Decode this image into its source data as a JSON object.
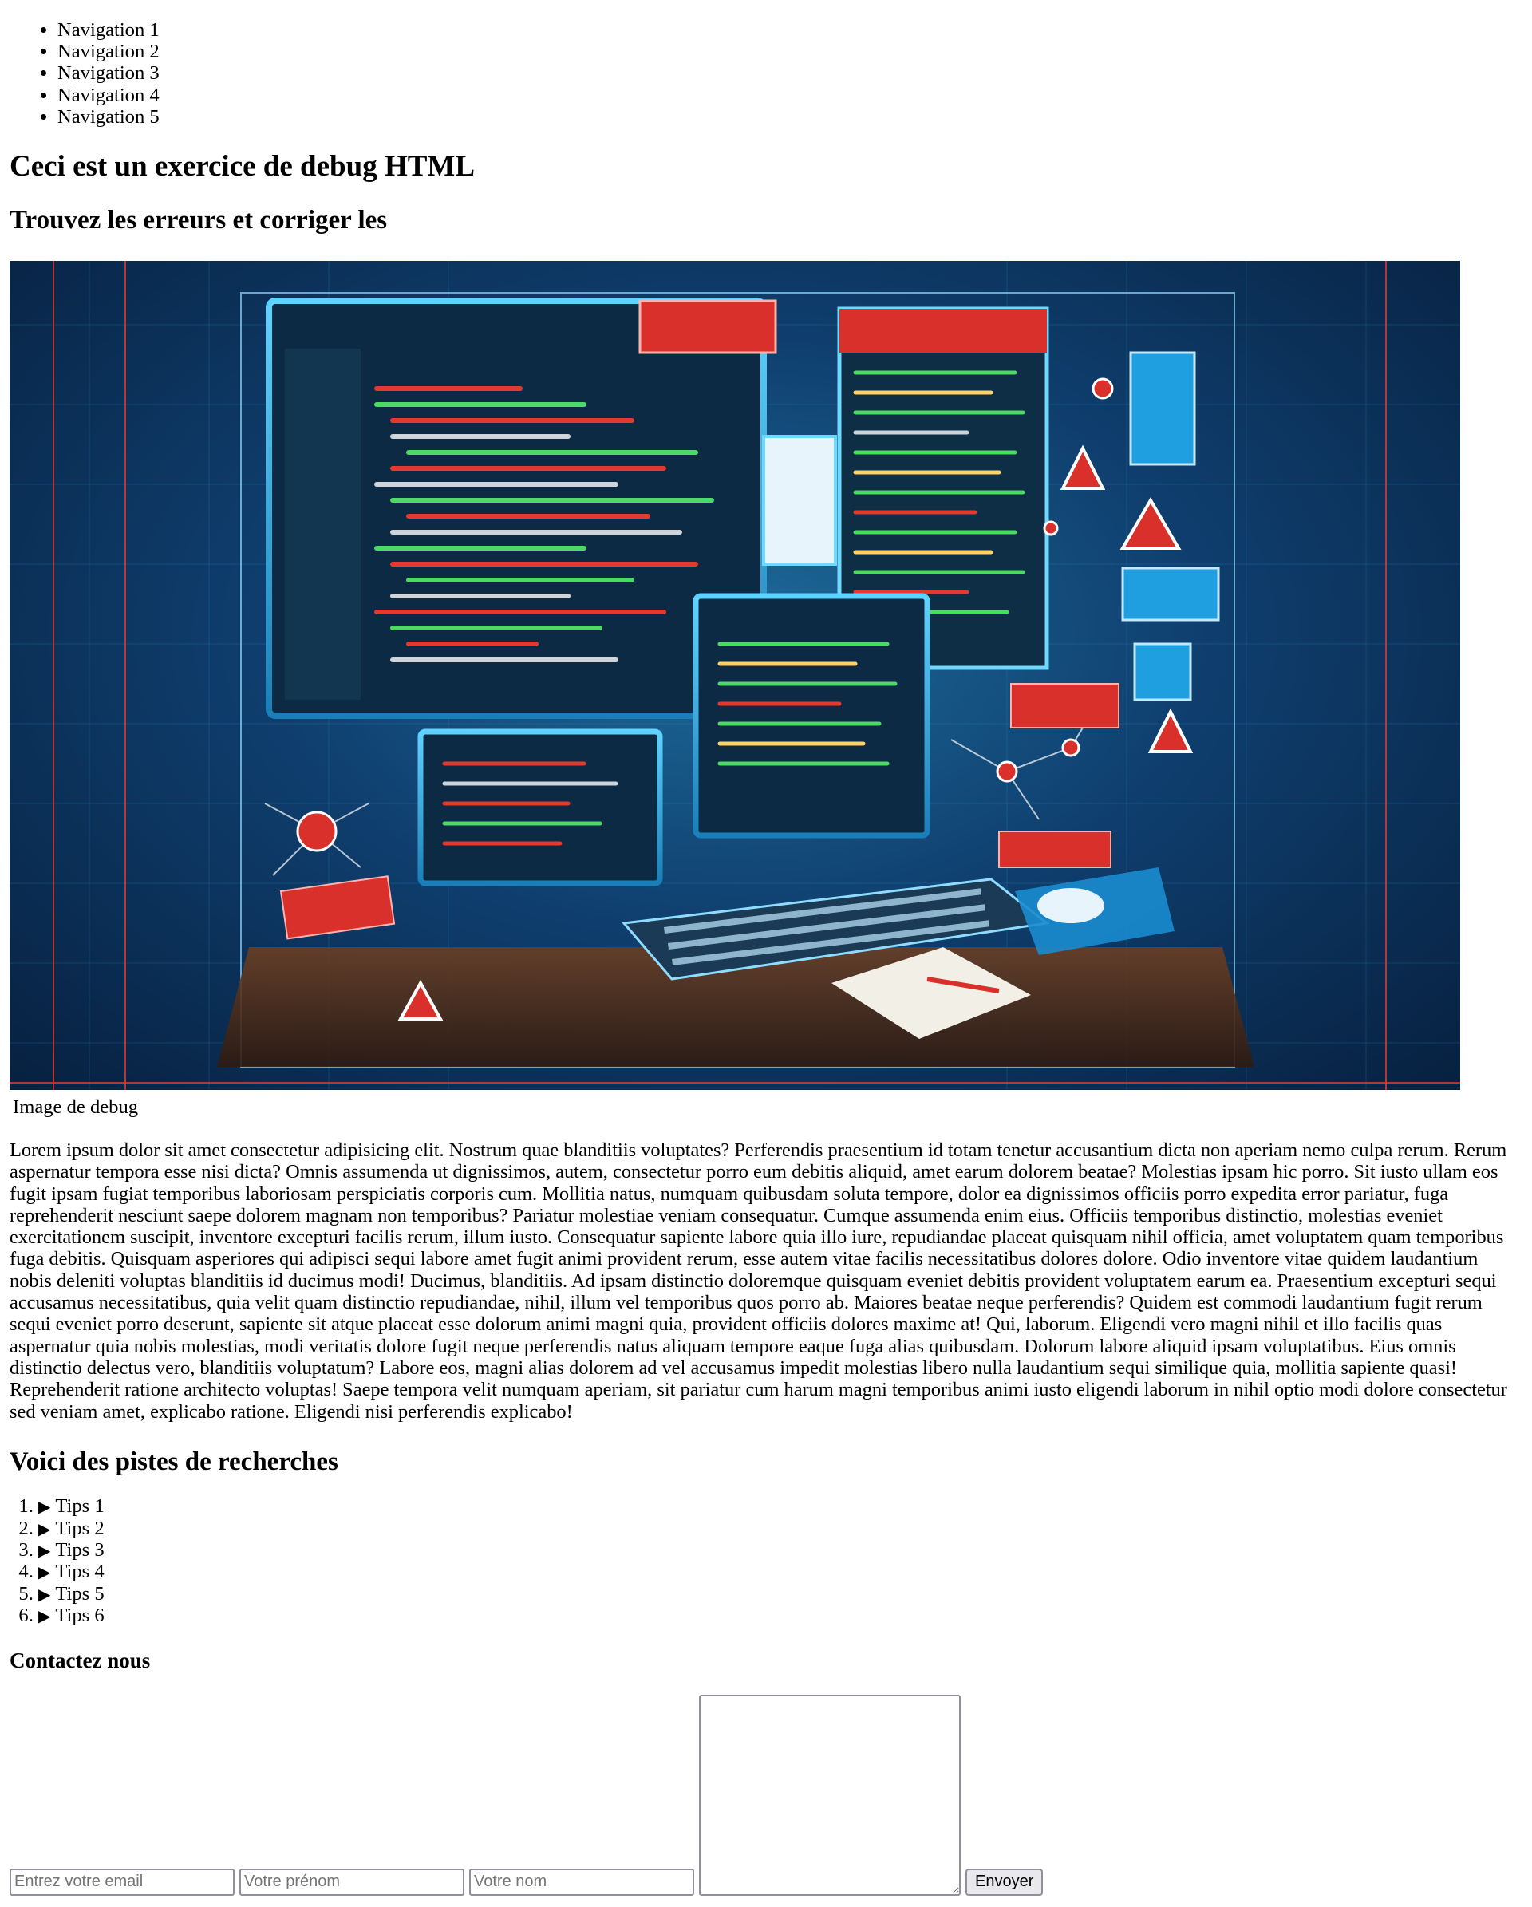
{
  "nav": {
    "items": [
      "Navigation 1",
      "Navigation 2",
      "Navigation 3",
      "Navigation 4",
      "Navigation 5"
    ]
  },
  "header": {
    "title": "Ceci est un exercice de debug HTML",
    "subtitle": "Trouvez les erreurs et corriger les"
  },
  "figure": {
    "caption": "Image de debug",
    "image_alt": "Image de debug"
  },
  "main": {
    "paragraph": "Lorem ipsum dolor sit amet consectetur adipisicing elit. Nostrum quae blanditiis voluptates? Perferendis praesentium id totam tenetur accusantium dicta non aperiam nemo culpa rerum. Rerum aspernatur tempora esse nisi dicta? Omnis assumenda ut dignissimos, autem, consectetur porro eum debitis aliquid, amet earum dolorem beatae? Molestias ipsam hic porro. Sit iusto ullam eos fugit ipsam fugiat temporibus laboriosam perspiciatis corporis cum. Mollitia natus, numquam quibusdam soluta tempore, dolor ea dignissimos officiis porro expedita error pariatur, fuga reprehenderit nesciunt saepe dolorem magnam non temporibus? Pariatur molestiae veniam consequatur. Cumque assumenda enim eius. Officiis temporibus distinctio, molestias eveniet exercitationem suscipit, inventore excepturi facilis rerum, illum iusto. Consequatur sapiente labore quia illo iure, repudiandae placeat quisquam nihil officia, amet voluptatem quam temporibus fuga debitis. Quisquam asperiores qui adipisci sequi labore amet fugit animi provident rerum, esse autem vitae facilis necessitatibus dolores dolore. Odio inventore vitae quidem laudantium nobis deleniti voluptas blanditiis id ducimus modi! Ducimus, blanditiis. Ad ipsam distinctio doloremque quisquam eveniet debitis provident voluptatem earum ea. Praesentium excepturi sequi accusamus necessitatibus, quia velit quam distinctio repudiandae, nihil, illum vel temporibus quos porro ab. Maiores beatae neque perferendis? Quidem est commodi laudantium fugit rerum sequi eveniet porro deserunt, sapiente sit atque placeat esse dolorum animi magni quia, provident officiis dolores maxime at! Qui, laborum. Eligendi vero magni nihil et illo facilis quas aspernatur quia nobis molestias, modi veritatis dolore fugit neque perferendis natus aliquam tempore eaque fuga alias quibusdam. Dolorum labore aliquid ipsam voluptatibus. Eius omnis distinctio delectus vero, blanditiis voluptatum? Labore eos, magni alias dolorem ad vel accusamus impedit molestias libero nulla laudantium sequi similique quia, mollitia sapiente quasi! Reprehenderit ratione architecto voluptas! Saepe tempora velit numquam aperiam, sit pariatur cum harum magni temporibus animi iusto eligendi laborum in nihil optio modi dolore consectetur sed veniam amet, explicabo ratione. Eligendi nisi perferendis explicabo!"
  },
  "tips": {
    "title": "Voici des pistes de recherches",
    "items": [
      "Tips 1",
      "Tips 2",
      "Tips 3",
      "Tips 4",
      "Tips 5",
      "Tips 6"
    ],
    "disclosure_glyph": "▶"
  },
  "contact": {
    "title": "Contactez nous",
    "email_placeholder": "Entrez votre email",
    "firstname_placeholder": "Votre prénom",
    "lastname_placeholder": "Votre nom",
    "message_value": "",
    "submit_label": "Envoyer"
  },
  "colors": {
    "hero_background": "#0f3f6f",
    "hero_accent_red": "#d9302b",
    "hero_accent_cyan": "#6fd8ff",
    "button_background": "#e9e9ed",
    "input_border": "#8f8f9d"
  }
}
